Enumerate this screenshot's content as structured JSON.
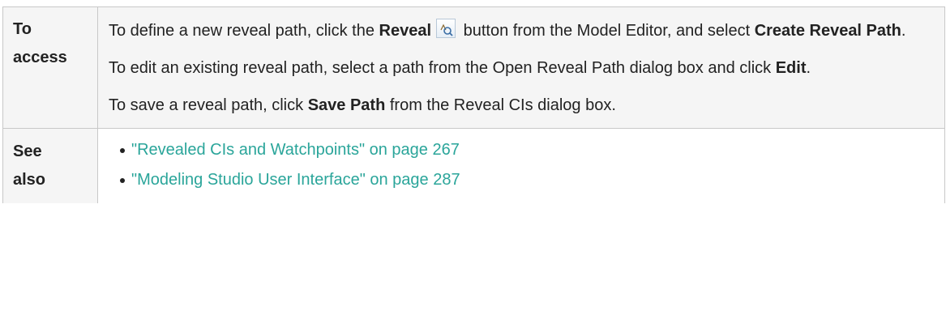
{
  "access": {
    "label_line1": "To",
    "label_line2": "access",
    "p1_prefix": "To define a new reveal path, click the ",
    "p1_bold1": "Reveal",
    "reveal_icon": "reveal-search-icon",
    "p1_middle": " button from the Model Editor, and select ",
    "p1_bold2": "Create Reveal Path",
    "p1_suffix": ".",
    "p2_prefix": "To edit an existing reveal path, select a path from the Open Reveal Path dialog box and click ",
    "p2_bold": "Edit",
    "p2_suffix": ".",
    "p3_prefix": "To save a reveal path, click ",
    "p3_bold": "Save Path",
    "p3_suffix": " from the Reveal CIs dialog box."
  },
  "see_also": {
    "label_line1": "See",
    "label_line2": "also",
    "links": [
      {
        "text": "\"Revealed CIs and Watchpoints\" on page 267"
      },
      {
        "text": "\"Modeling Studio User Interface\" on page 287"
      }
    ],
    "link_color": "#2aa59a"
  }
}
